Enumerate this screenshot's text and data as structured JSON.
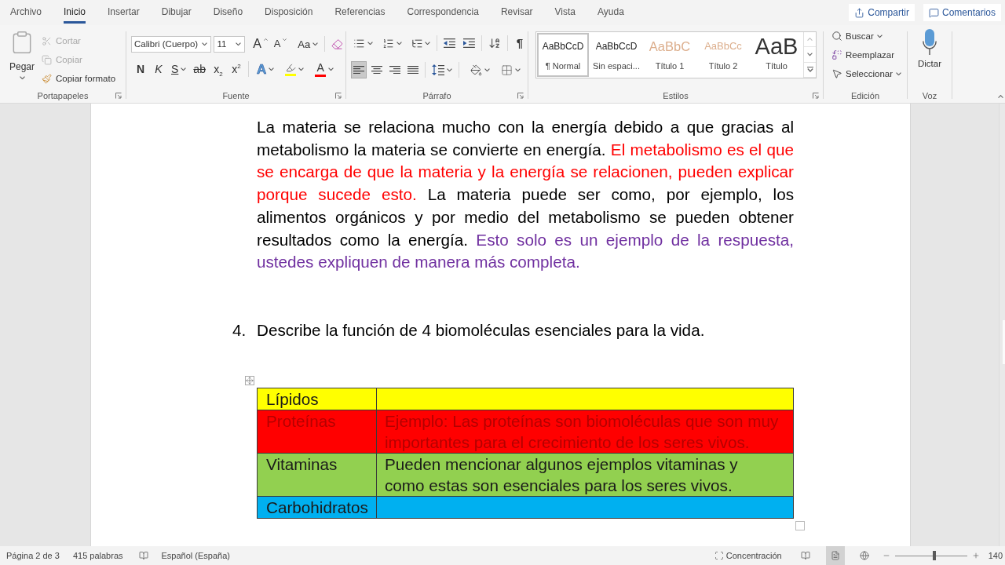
{
  "tabs": [
    {
      "label": "Archivo",
      "selected": false
    },
    {
      "label": "Inicio",
      "selected": true
    },
    {
      "label": "Insertar",
      "selected": false
    },
    {
      "label": "Dibujar",
      "selected": false
    },
    {
      "label": "Diseño",
      "selected": false
    },
    {
      "label": "Disposición",
      "selected": false
    },
    {
      "label": "Referencias",
      "selected": false
    },
    {
      "label": "Correspondencia",
      "selected": false
    },
    {
      "label": "Revisar",
      "selected": false
    },
    {
      "label": "Vista",
      "selected": false
    },
    {
      "label": "Ayuda",
      "selected": false
    }
  ],
  "header_buttons": [
    {
      "label": "Compartir",
      "kind": "share"
    },
    {
      "label": "Comentarios",
      "kind": "comment"
    }
  ],
  "ribbon": {
    "clipboard": {
      "paste": "Pegar",
      "items": [
        {
          "label": "Cortar",
          "kind": "cut",
          "disabled": true
        },
        {
          "label": "Copiar",
          "kind": "copy",
          "disabled": true
        },
        {
          "label": "Copiar formato",
          "kind": "painter",
          "disabled": false
        }
      ],
      "group_label": "Portapapeles"
    },
    "font": {
      "font_name": "Calibri (Cuerpo)",
      "font_size": "11",
      "size_buttons": [
        {
          "label": "A",
          "kind": "grow"
        },
        {
          "label": "A",
          "kind": "shrink"
        }
      ],
      "case_button": "Aa",
      "format_buttons": [
        {
          "label": "N",
          "kind": "bold"
        },
        {
          "label": "K",
          "kind": "italic"
        },
        {
          "label": "S",
          "kind": "underline"
        },
        {
          "label": "ab",
          "kind": "strike"
        },
        {
          "label": "x$_{2}$",
          "kind": "sub"
        },
        {
          "label": "x$^{2}$",
          "kind": "sup"
        }
      ],
      "color_buttons": [
        {
          "label": "A",
          "kind": "effects"
        },
        {
          "kind": "highlight",
          "color": "#ffff00"
        },
        {
          "label": "A",
          "kind": "font_color",
          "color": "#ff0000"
        }
      ],
      "group_label": "Fuente"
    },
    "paragraph": {
      "show_marks": "¶",
      "alignment": [
        {
          "kind": "left",
          "selected": true
        },
        {
          "kind": "center",
          "selected": false
        },
        {
          "kind": "right",
          "selected": false
        },
        {
          "kind": "justify",
          "selected": false
        }
      ],
      "group_label": "Párrafo"
    },
    "styles": {
      "items": [
        {
          "preview": "AaBbCcD",
          "label": "¶ Normal",
          "kind": "normal",
          "selected": true
        },
        {
          "preview": "AaBbCcD",
          "label": "Sin espaci...",
          "kind": "normal",
          "selected": false
        },
        {
          "preview": "AaBbC",
          "label": "Título 1",
          "kind": "heading1",
          "selected": false
        },
        {
          "preview": "AaBbCc",
          "label": "Título 2",
          "kind": "heading2",
          "selected": false
        },
        {
          "preview": "AaB",
          "label": "Título",
          "kind": "title",
          "selected": false
        }
      ],
      "group_label": "Estilos"
    },
    "editing": {
      "items": [
        {
          "label": "Buscar",
          "kind": "find",
          "dropdown": true
        },
        {
          "label": "Reemplazar",
          "kind": "replace",
          "dropdown": false
        },
        {
          "label": "Seleccionar",
          "kind": "select",
          "dropdown": true
        }
      ],
      "group_label": "Edición"
    },
    "voice": {
      "button": "Dictar",
      "group_label": "Voz"
    }
  },
  "document": {
    "paragraph": [
      {
        "text": "La materia se relaciona mucho con la energía debido a que gracias al metabolismo la materia se convierte en energía. ",
        "color": "#000000"
      },
      {
        "text": "El metabolismo es el que se encarga de que la materia y la energía se relacionen, pueden explicar porque sucede esto.",
        "color": "#ff0000"
      },
      {
        "text": " La materia puede ser como, por ejemplo, los alimentos orgánicos y por medio del metabolismo se pueden obtener resultados como la energía.",
        "color": "#000000"
      },
      {
        "text": " Esto solo es un ejemplo de la respuesta, ustedes expliquen de manera más completa.",
        "color": "#7030a0"
      }
    ],
    "question": {
      "number": "4.",
      "text": "Describe la función de 4 biomoléculas esenciales para la vida."
    },
    "table": {
      "rows": [
        {
          "color": "#ffff00",
          "kind": "plain",
          "cells": [
            "Lípidos"
          ]
        },
        {
          "color": "#ff0000",
          "kind": "tinted",
          "cells": [
            "Proteínas",
            "Ejemplo: Las proteínas son biomoléculas que son muy importantes para el crecimiento de los seres vivos."
          ]
        },
        {
          "color": "#92d050",
          "kind": "plain",
          "cells": [
            "Vitaminas",
            "Pueden mencionar algunos ejemplos vitaminas y como estas son esenciales para los seres vivos."
          ]
        },
        {
          "color": "#00b0f0",
          "kind": "plain",
          "cells": [
            "Carbohidratos"
          ]
        }
      ]
    }
  },
  "status_bar": {
    "page": "Página 2 de 3",
    "words": "415 palabras",
    "language": "Español (España)",
    "focus": "Concentración",
    "views": [
      {
        "kind": "read",
        "selected": false
      },
      {
        "kind": "print",
        "selected": true
      },
      {
        "kind": "web",
        "selected": false
      }
    ],
    "zoom": {
      "level": 0.55,
      "reading": "140"
    }
  }
}
